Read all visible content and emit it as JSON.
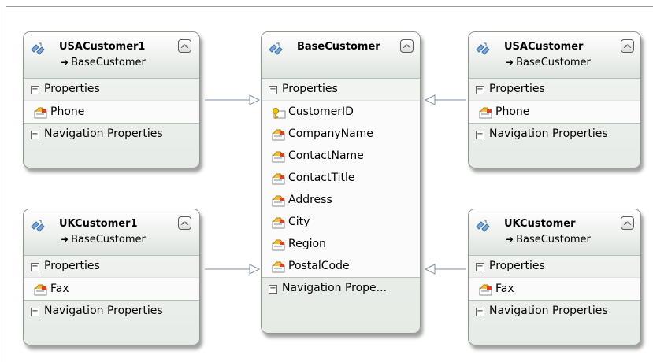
{
  "colors": {
    "border": "#8b9a8b",
    "header_bg": "#eef1ee",
    "connector": "#7f8fa6",
    "key_gold": "#d9a400"
  },
  "icons": {
    "entity": "entity-type-icon",
    "property": "scalar-property-icon",
    "key": "key-property-icon",
    "collapse": "double-chevron-up-icon",
    "expander": "minus-expander-icon",
    "inherits": "right-arrow-icon"
  },
  "entities": {
    "usacustomer1": {
      "name": "USACustomer1",
      "base": "BaseCustomer",
      "properties_label": "Properties",
      "properties": [
        "Phone"
      ],
      "navigation_label": "Navigation Properties"
    },
    "basecustomer": {
      "name": "BaseCustomer",
      "properties_label": "Properties",
      "key_property": "CustomerID",
      "properties": [
        "CompanyName",
        "ContactName",
        "ContactTitle",
        "Address",
        "City",
        "Region",
        "PostalCode"
      ],
      "navigation_label": "Navigation  Prope..."
    },
    "usacustomer": {
      "name": "USACustomer",
      "base": "BaseCustomer",
      "properties_label": "Properties",
      "properties": [
        "Phone"
      ],
      "navigation_label": "Navigation Properties"
    },
    "ukcustomer1": {
      "name": "UKCustomer1",
      "base": "BaseCustomer",
      "properties_label": "Properties",
      "properties": [
        "Fax"
      ],
      "navigation_label": "Navigation Properties"
    },
    "ukcustomer": {
      "name": "UKCustomer",
      "base": "BaseCustomer",
      "properties_label": "Properties",
      "properties": [
        "Fax"
      ],
      "navigation_label": "Navigation Properties"
    }
  }
}
